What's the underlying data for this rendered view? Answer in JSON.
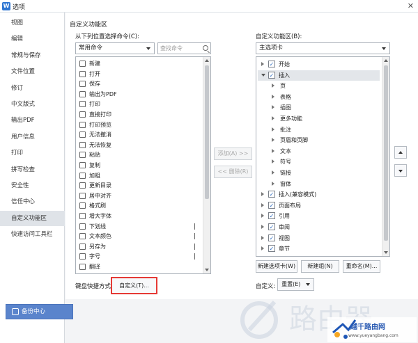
{
  "window": {
    "title": "选项",
    "app_icon_letter": "W",
    "close_symbol": "✕"
  },
  "sidebar": {
    "items": [
      {
        "label": "视图"
      },
      {
        "label": "编辑"
      },
      {
        "label": "常规与保存"
      },
      {
        "label": "文件位置"
      },
      {
        "label": "修订"
      },
      {
        "label": "中文版式"
      },
      {
        "label": "输出PDF"
      },
      {
        "label": "用户信息"
      },
      {
        "label": "打印"
      },
      {
        "label": "拼写检查"
      },
      {
        "label": "安全性"
      },
      {
        "label": "信任中心"
      },
      {
        "label": "自定义功能区",
        "active": true
      },
      {
        "label": "快速访问工具栏"
      }
    ],
    "backup_button": "备份中心"
  },
  "main": {
    "section_title": "自定义功能区",
    "left": {
      "label": "从下列位置选择命令(C):",
      "dropdown_value": "常用命令",
      "search_placeholder": "查找命令",
      "commands": [
        {
          "label": "新建",
          "icon": "new-doc-icon"
        },
        {
          "label": "打开",
          "icon": "folder-open-icon"
        },
        {
          "label": "保存",
          "icon": "save-icon"
        },
        {
          "label": "输出为PDF",
          "icon": "pdf-icon"
        },
        {
          "label": "打印",
          "icon": "printer-icon"
        },
        {
          "label": "直接打印",
          "icon": "printer-icon"
        },
        {
          "label": "打印预览",
          "icon": "print-preview-icon"
        },
        {
          "label": "无法撤消",
          "icon": "undo-icon"
        },
        {
          "label": "无法恢复",
          "icon": "redo-icon"
        },
        {
          "label": "粘贴",
          "icon": "paste-icon"
        },
        {
          "label": "复制",
          "icon": "copy-icon"
        },
        {
          "label": "加粗",
          "icon": "bold-icon"
        },
        {
          "label": "更新目录",
          "icon": "update-toc-icon"
        },
        {
          "label": "居中对齐",
          "icon": "align-center-icon"
        },
        {
          "label": "格式刷",
          "icon": "format-painter-icon"
        },
        {
          "label": "增大字体",
          "icon": "font-grow-icon"
        },
        {
          "label": "下划线",
          "icon": "underline-icon",
          "submenu": true
        },
        {
          "label": "文本颜色",
          "icon": "font-color-icon",
          "submenu": true
        },
        {
          "label": "另存为",
          "icon": "save-as-icon",
          "submenu": true
        },
        {
          "label": "字号",
          "icon": "font-size-icon",
          "submenu": true
        },
        {
          "label": "翻译",
          "icon": "translate-icon"
        }
      ],
      "shortcut_label": "键盘快捷方式:",
      "customize_button": "自定义(T)..."
    },
    "middle": {
      "add_button": "添加(A) >>",
      "remove_button": "<< 删除(R)"
    },
    "right": {
      "label": "自定义功能区(B):",
      "dropdown_value": "主选项卡",
      "tree": [
        {
          "label": "开始",
          "level": 0,
          "checkbox": true,
          "expanded": false
        },
        {
          "label": "插入",
          "level": 0,
          "checkbox": true,
          "expanded": true,
          "selected": true
        },
        {
          "label": "页",
          "level": 1,
          "checkbox": false
        },
        {
          "label": "表格",
          "level": 1,
          "checkbox": false
        },
        {
          "label": "插图",
          "level": 1,
          "checkbox": false
        },
        {
          "label": "更多功能",
          "level": 1,
          "checkbox": false
        },
        {
          "label": "批注",
          "level": 1,
          "checkbox": false
        },
        {
          "label": "页眉和页脚",
          "level": 1,
          "checkbox": false
        },
        {
          "label": "文本",
          "level": 1,
          "checkbox": false
        },
        {
          "label": "符号",
          "level": 1,
          "checkbox": false
        },
        {
          "label": "链接",
          "level": 1,
          "checkbox": false
        },
        {
          "label": "窗体",
          "level": 1,
          "checkbox": false
        },
        {
          "label": "插入(兼容模式)",
          "level": 0,
          "checkbox": true,
          "expanded": false
        },
        {
          "label": "页面布局",
          "level": 0,
          "checkbox": true,
          "expanded": false
        },
        {
          "label": "引用",
          "level": 0,
          "checkbox": true,
          "expanded": false
        },
        {
          "label": "审阅",
          "level": 0,
          "checkbox": true,
          "expanded": false
        },
        {
          "label": "视图",
          "level": 0,
          "checkbox": true,
          "expanded": false
        },
        {
          "label": "章节",
          "level": 0,
          "checkbox": true,
          "expanded": false
        }
      ],
      "check_symbol": "✓",
      "new_tab_button": "新建选项卡(W)",
      "new_group_button": "新建组(N)",
      "rename_button": "重命名(M)...",
      "customize_label": "自定义:",
      "reset_button": "重置(E)"
    }
  },
  "watermark": {
    "site_name": "路由器",
    "brand_text": "越千路由网",
    "url": "www.yueyangbang.com"
  }
}
